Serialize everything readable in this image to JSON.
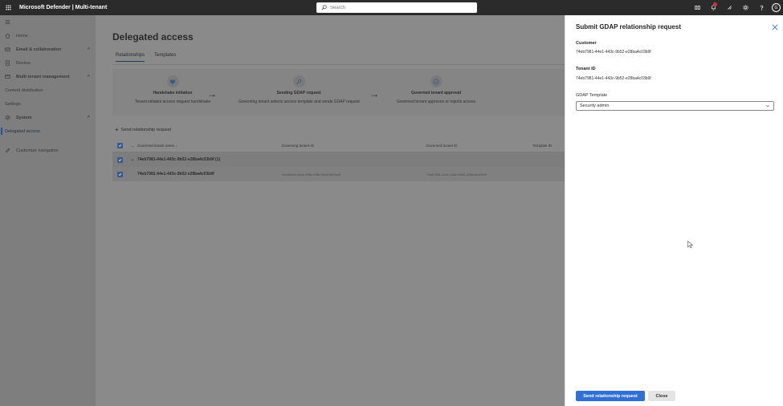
{
  "app": {
    "title": "Microsoft Defender | Multi-tenant",
    "avatar_initial": "G"
  },
  "search": {
    "placeholder": "Search"
  },
  "nav": {
    "items": [
      {
        "label": "Home"
      },
      {
        "label": "Email & collaboration"
      },
      {
        "label": "Review"
      },
      {
        "label": "Multi-tenant management"
      },
      {
        "label": "Content distribution"
      },
      {
        "label": "Settings"
      },
      {
        "label": "System"
      },
      {
        "label": "Delegated access"
      },
      {
        "label": "Customize navigation"
      }
    ]
  },
  "main": {
    "title": "Delegated access",
    "tabs": [
      {
        "label": "Relationships"
      },
      {
        "label": "Templates"
      }
    ],
    "steps": [
      {
        "title": "Handshake initiation",
        "desc": "Tenant initiates access request handshake"
      },
      {
        "title": "Sending GDAP request",
        "desc": "Governing tenant selects access template and sends GDAP request"
      },
      {
        "title": "Governed tenant approval",
        "desc": "Governed tenant approves or rejects access"
      }
    ],
    "send_request_label": "Send relationship request",
    "table": {
      "headers": [
        "Governed tenant name ↓",
        "Governing tenant ID",
        "Governed tenant ID",
        "Template ID"
      ],
      "group_row": "74eb7981-44e1-443c-9b52-e28ba4c03b9f (1)",
      "item_row": {
        "name": "74eb7981-44e1-443c-9b52-e28ba4c03b9f",
        "governing_id": "00c5bede-e5eb-49be-b5fb-5bf4d3ef7ae5",
        "governed_id": "74eb7981-44e1-443c-9b52-e28ba4c03b9f"
      }
    }
  },
  "panel": {
    "title": "Submit GDAP relationship request",
    "customer_label": "Customer",
    "customer_value": "74eb7981-44e1-443c-9b52-e28ba4c03b9f",
    "tenant_label": "Tenant ID",
    "tenant_value": "74eb7981-44e1-443c-9b52-e28ba4c03b9f",
    "template_label": "GDAP Template",
    "template_selected": "Security admin",
    "submit_label": "Send relationship request",
    "close_label": "Close"
  },
  "colors": {
    "topbar": "#2b2b2b",
    "primary_button": "#2f6fd6",
    "notification": "#d13438",
    "overlay": "#8a8a8a"
  }
}
